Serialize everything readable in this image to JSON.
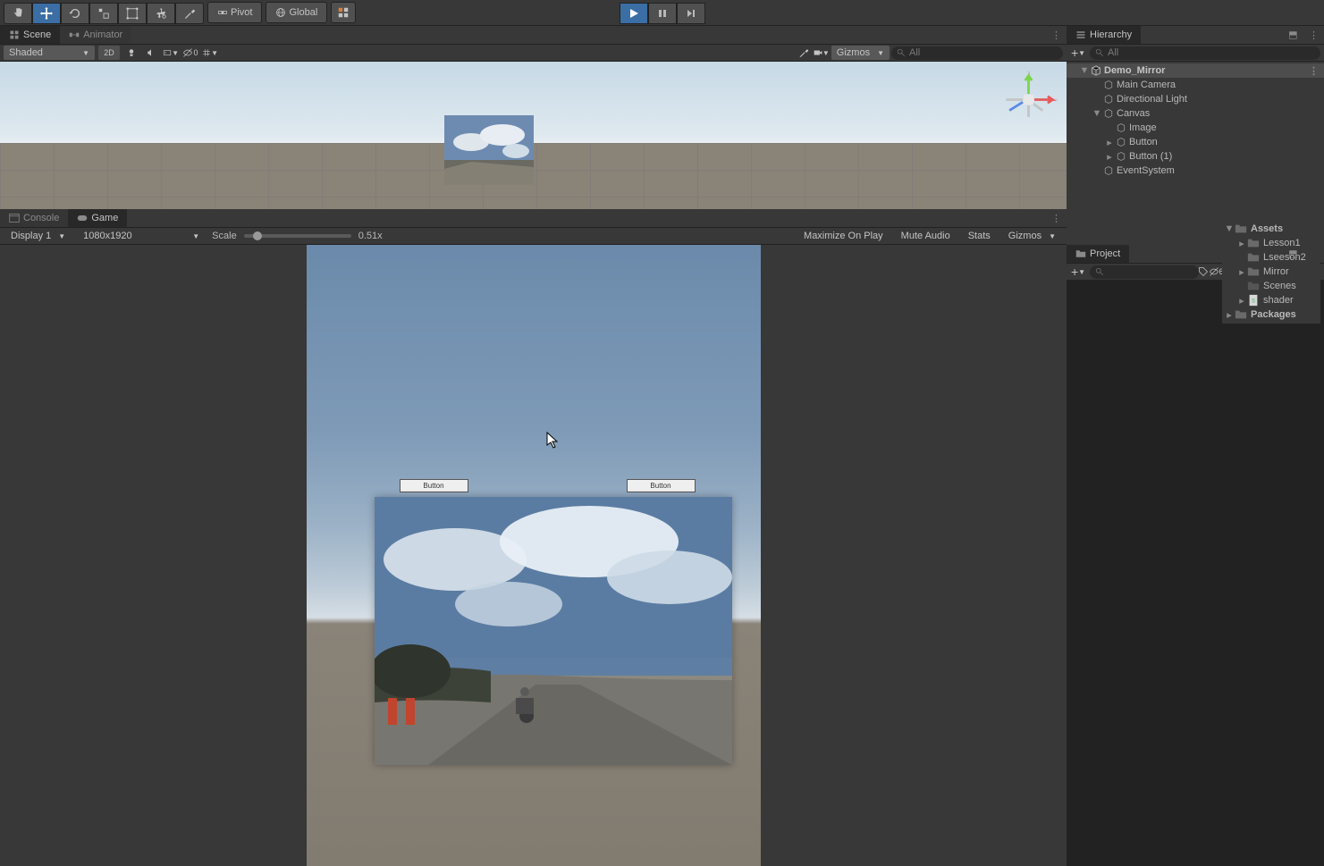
{
  "toolbar": {
    "pivot": "Pivot",
    "global": "Global"
  },
  "tabs": {
    "scene": "Scene",
    "animator": "Animator",
    "console": "Console",
    "game": "Game",
    "hierarchy": "Hierarchy",
    "project": "Project"
  },
  "scene": {
    "shading": "Shaded",
    "mode2d": "2D",
    "gizmos": "Gizmos",
    "search_placeholder": "All",
    "layers_badge": "0"
  },
  "game": {
    "display": "Display 1",
    "resolution": "1080x1920",
    "scale_label": "Scale",
    "scale_value": "0.51x",
    "maximize": "Maximize On Play",
    "mute": "Mute Audio",
    "stats": "Stats",
    "gizmos": "Gizmos",
    "button1": "Button",
    "button2": "Button"
  },
  "hierarchy": {
    "search_placeholder": "All",
    "root": "Demo_Mirror",
    "items": [
      "Main Camera",
      "Directional Light",
      "Canvas",
      "Image",
      "Button",
      "Button (1)",
      "EventSystem"
    ]
  },
  "project": {
    "search_placeholder": "",
    "root": "Assets",
    "items": [
      "Lesson1",
      "Lseeson2",
      "Mirror",
      "Scenes",
      "shader"
    ],
    "packages": "Packages"
  }
}
